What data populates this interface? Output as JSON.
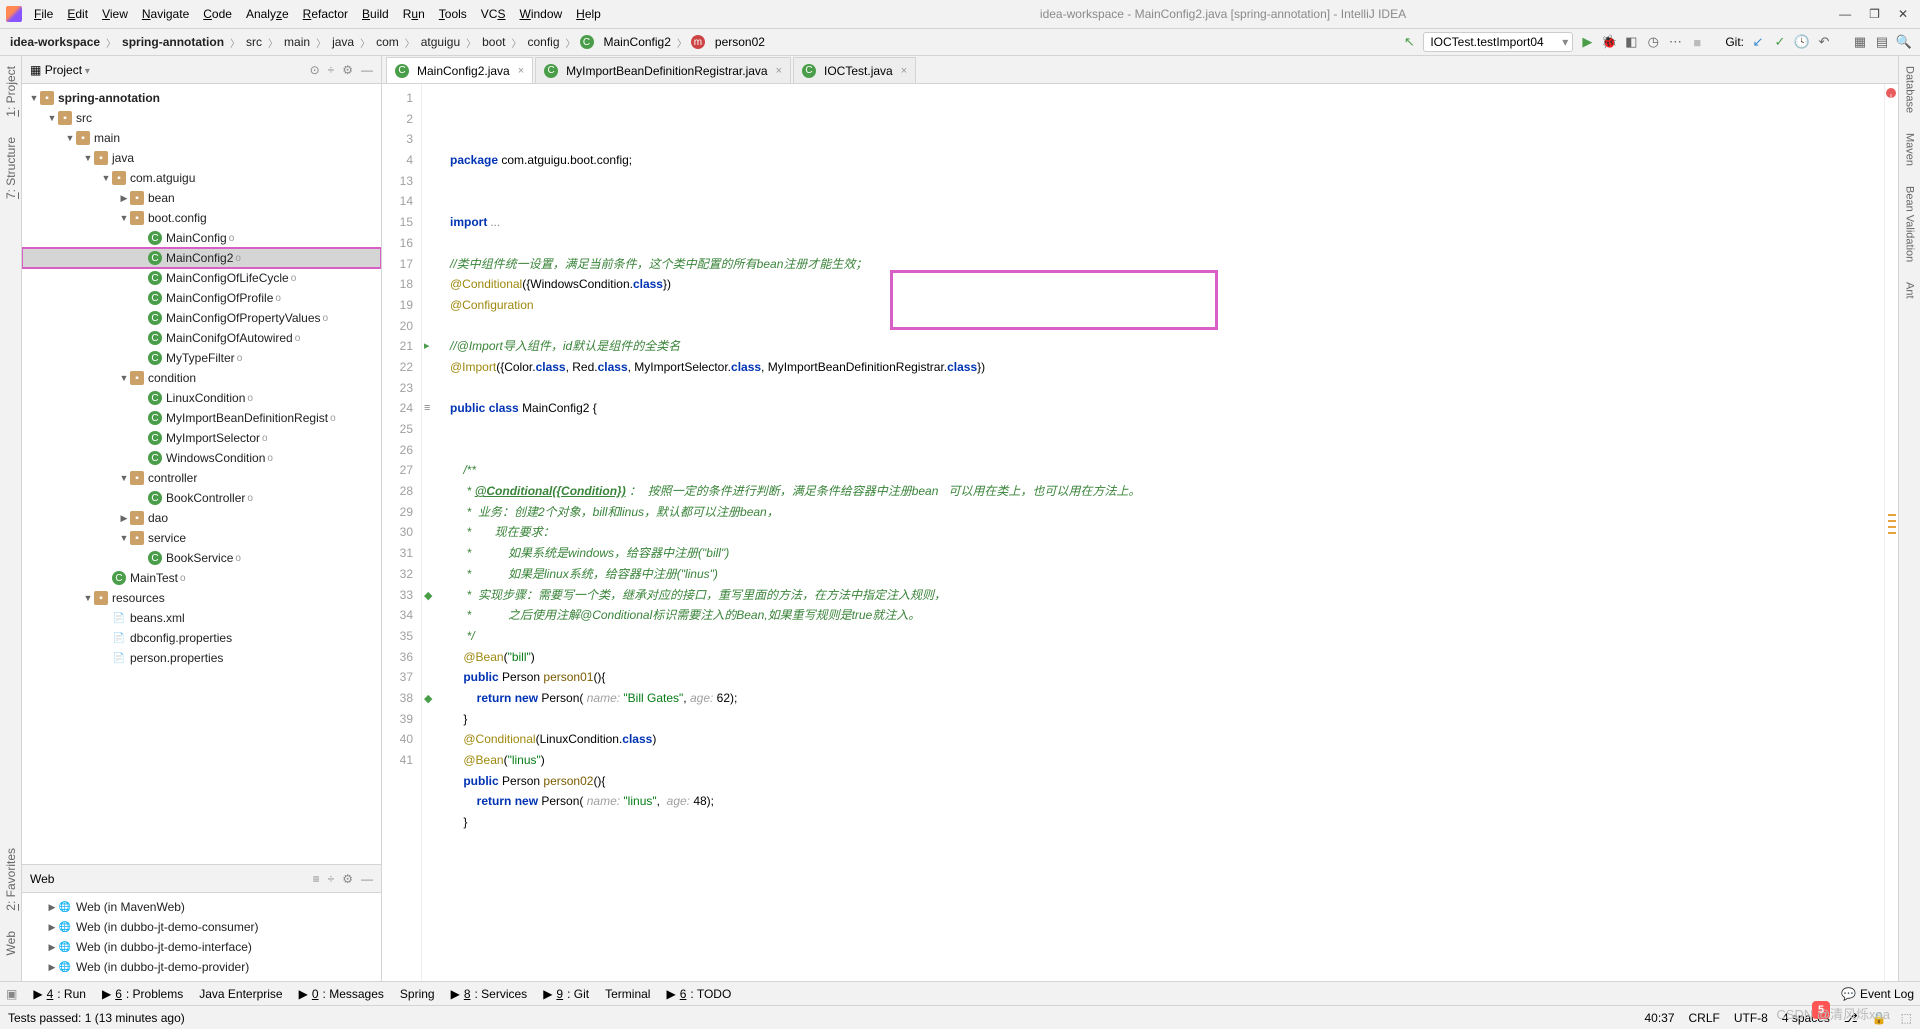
{
  "window": {
    "title": "idea-workspace - MainConfig2.java [spring-annotation] - IntelliJ IDEA"
  },
  "menu": [
    "File",
    "Edit",
    "View",
    "Navigate",
    "Code",
    "Analyze",
    "Refactor",
    "Build",
    "Run",
    "Tools",
    "VCS",
    "Window",
    "Help"
  ],
  "breadcrumb": [
    "idea-workspace",
    "spring-annotation",
    "src",
    "main",
    "java",
    "com",
    "atguigu",
    "boot",
    "config",
    "MainConfig2",
    "person02"
  ],
  "run_config": "IOCTest.testImport04",
  "git_label": "Git:",
  "left_gutter": [
    {
      "num": "1:",
      "label": "Project"
    },
    {
      "num": "7:",
      "label": "Structure"
    },
    {
      "num": "2:",
      "label": "Favorites"
    },
    {
      "num": "",
      "label": "Web"
    }
  ],
  "right_gutter": [
    "Database",
    "Maven",
    "Bean Validation",
    "Ant"
  ],
  "project_panel": {
    "title": "Project"
  },
  "tree": {
    "root": "spring-annotation",
    "nodes": [
      {
        "d": 1,
        "tw": "▼",
        "ic": "fold",
        "t": "src"
      },
      {
        "d": 2,
        "tw": "▼",
        "ic": "fold",
        "t": "main"
      },
      {
        "d": 3,
        "tw": "▼",
        "ic": "fold",
        "t": "java"
      },
      {
        "d": 4,
        "tw": "▼",
        "ic": "fold",
        "t": "com.atguigu"
      },
      {
        "d": 5,
        "tw": "▶",
        "ic": "fold",
        "t": "bean"
      },
      {
        "d": 5,
        "tw": "▼",
        "ic": "fold",
        "t": "boot.config"
      },
      {
        "d": 6,
        "tw": "",
        "ic": "class",
        "t": "MainConfig",
        "mod": "o"
      },
      {
        "d": 6,
        "tw": "",
        "ic": "class",
        "t": "MainConfig2",
        "mod": "o",
        "sel": true,
        "hl": true
      },
      {
        "d": 6,
        "tw": "",
        "ic": "class",
        "t": "MainConfigOfLifeCycle",
        "mod": "o"
      },
      {
        "d": 6,
        "tw": "",
        "ic": "class",
        "t": "MainConfigOfProfile",
        "mod": "o"
      },
      {
        "d": 6,
        "tw": "",
        "ic": "class",
        "t": "MainConfigOfPropertyValues",
        "mod": "o"
      },
      {
        "d": 6,
        "tw": "",
        "ic": "class",
        "t": "MainConifgOfAutowired",
        "mod": "o"
      },
      {
        "d": 6,
        "tw": "",
        "ic": "class",
        "t": "MyTypeFilter",
        "mod": "o"
      },
      {
        "d": 5,
        "tw": "▼",
        "ic": "fold",
        "t": "condition"
      },
      {
        "d": 6,
        "tw": "",
        "ic": "class",
        "t": "LinuxCondition",
        "mod": "o"
      },
      {
        "d": 6,
        "tw": "",
        "ic": "class",
        "t": "MyImportBeanDefinitionRegist",
        "mod": "o"
      },
      {
        "d": 6,
        "tw": "",
        "ic": "class",
        "t": "MyImportSelector",
        "mod": "o"
      },
      {
        "d": 6,
        "tw": "",
        "ic": "class",
        "t": "WindowsCondition",
        "mod": "o"
      },
      {
        "d": 5,
        "tw": "▼",
        "ic": "fold",
        "t": "controller"
      },
      {
        "d": 6,
        "tw": "",
        "ic": "class",
        "t": "BookController",
        "mod": "o"
      },
      {
        "d": 5,
        "tw": "▶",
        "ic": "fold",
        "t": "dao"
      },
      {
        "d": 5,
        "tw": "▼",
        "ic": "fold",
        "t": "service"
      },
      {
        "d": 6,
        "tw": "",
        "ic": "class",
        "t": "BookService",
        "mod": "o"
      },
      {
        "d": 4,
        "tw": "",
        "ic": "class",
        "t": "MainTest",
        "mod": "o"
      },
      {
        "d": 3,
        "tw": "▼",
        "ic": "fold",
        "t": "resources"
      },
      {
        "d": 4,
        "tw": "",
        "ic": "xml",
        "t": "beans.xml"
      },
      {
        "d": 4,
        "tw": "",
        "ic": "prop",
        "t": "dbconfig.properties"
      },
      {
        "d": 4,
        "tw": "",
        "ic": "prop",
        "t": "person.properties"
      }
    ]
  },
  "web_panel": {
    "title": "Web",
    "items": [
      "Web (in MavenWeb)",
      "Web (in dubbo-jt-demo-consumer)",
      "Web (in dubbo-jt-demo-interface)",
      "Web (in dubbo-jt-demo-provider)"
    ]
  },
  "tabs": [
    {
      "name": "MainConfig2.java",
      "active": true
    },
    {
      "name": "MyImportBeanDefinitionRegistrar.java",
      "active": false
    },
    {
      "name": "IOCTest.java",
      "active": false
    }
  ],
  "code": {
    "lines": [
      {
        "n": 1,
        "h": "<span class='k'>package</span> com.atguigu.boot.config;"
      },
      {
        "n": 2,
        "h": ""
      },
      {
        "n": 3,
        "h": ""
      },
      {
        "n": 4,
        "h": "<span class='k'>import</span> <span class='cm'>...</span>"
      },
      {
        "n": 13,
        "h": ""
      },
      {
        "n": 14,
        "h": "<span class='cm-g'>//类中组件统一设置，满足当前条件，这个类中配置的所有bean注册才能生效；</span>"
      },
      {
        "n": 15,
        "h": "<span class='an'>@Conditional</span>({WindowsCondition.<span class='k'>class</span>})"
      },
      {
        "n": 16,
        "h": "<span class='an'>@Configuration</span>"
      },
      {
        "n": 17,
        "h": ""
      },
      {
        "n": 18,
        "h": "<span class='cm-g'>//@Import导入组件，id默认是组件的全类名</span>"
      },
      {
        "n": 19,
        "h": "<span class='an'>@Import</span>({Color.<span class='k'>class</span>, Red.<span class='k'>class</span>, MyImportSelector.<span class='k'>class</span>, MyImportBeanDefinitionRegistrar.<span class='k'>class</span>})"
      },
      {
        "n": 20,
        "h": ""
      },
      {
        "n": 21,
        "h": "<span class='k'>public</span> <span class='k'>class</span> <span class='cls'>MainConfig2</span> {"
      },
      {
        "n": 22,
        "h": ""
      },
      {
        "n": 23,
        "h": ""
      },
      {
        "n": 24,
        "h": "    <span class='cm-g'>/**</span>"
      },
      {
        "n": 25,
        "h": "<span class='cm-g'>     * <u><b>@Conditional({Condition})</b></u> ：  按照一定的条件进行判断，满足条件给容器中注册bean   可以用在类上，也可以用在方法上。</span>"
      },
      {
        "n": 26,
        "h": "<span class='cm-g'>     *  业务：创建2个对象，bill和linus，默认都可以注册bean，</span>"
      },
      {
        "n": 27,
        "h": "<span class='cm-g'>     *       现在要求：</span>"
      },
      {
        "n": 28,
        "h": "<span class='cm-g'>     *           如果系统是windows，给容器中注册(\"bill\")</span>"
      },
      {
        "n": 29,
        "h": "<span class='cm-g'>     *           如果是linux系统，给容器中注册(\"linus\")</span>"
      },
      {
        "n": 30,
        "h": "<span class='cm-g'>     *  实现步骤：需要写一个类，继承对应的接口，重写里面的方法，在方法中指定注入规则，</span>"
      },
      {
        "n": 31,
        "h": "<span class='cm-g'>     *           之后使用注解@Conditional标识需要注入的Bean,如果重写规则是true就注入。</span>"
      },
      {
        "n": 32,
        "h": "<span class='cm-g'>     */</span>"
      },
      {
        "n": 33,
        "h": "    <span class='an'>@Bean</span>(<span class='s'>\"bill\"</span>)"
      },
      {
        "n": 34,
        "h": "    <span class='k'>public</span> Person <span class='m'>person01</span>(){"
      },
      {
        "n": 35,
        "h": "        <span class='k'>return</span> <span class='k'>new</span> Person( <span class='hint'>name:</span> <span class='s'>\"Bill Gates\"</span>, <span class='hint'>age:</span> 62);"
      },
      {
        "n": 36,
        "h": "    }"
      },
      {
        "n": 37,
        "h": "    <span class='an'>@Conditional</span>(LinuxCondition.<span class='k'>class</span>)"
      },
      {
        "n": 38,
        "h": "    <span class='an'>@Bean</span>(<span class='s'>\"linus\"</span>)"
      },
      {
        "n": 39,
        "h": "    <span class='k'>public</span> Person <span class='m'>person02</span>(){"
      },
      {
        "n": 40,
        "h": "        <span class='k'>return</span> <span class='k'>new</span> Person( <span class='hint'>name:</span> <span class='s'>\"linus\"</span>,  <span class='hint'>age:</span> 48);"
      },
      {
        "n": 41,
        "h": "    }"
      }
    ]
  },
  "bottom_tabs": [
    {
      "u": "4",
      "t": ": Run"
    },
    {
      "u": "6",
      "t": ": Problems"
    },
    {
      "u": "",
      "t": "Java Enterprise"
    },
    {
      "u": "0",
      "t": ": Messages"
    },
    {
      "u": "",
      "t": "Spring"
    },
    {
      "u": "8",
      "t": ": Services"
    },
    {
      "u": "9",
      "t": ": Git"
    },
    {
      "u": "",
      "t": "Terminal"
    },
    {
      "u": "6",
      "t": ": TODO"
    }
  ],
  "event_log": "Event Log",
  "status": {
    "msg": "Tests passed: 1 (13 minutes ago)",
    "pos": "40:37",
    "le": "CRLF",
    "enc": "UTF-8",
    "indent": "4 spaces",
    "branch": "⎇"
  },
  "watermark": "CSDN @清风烁xaa"
}
